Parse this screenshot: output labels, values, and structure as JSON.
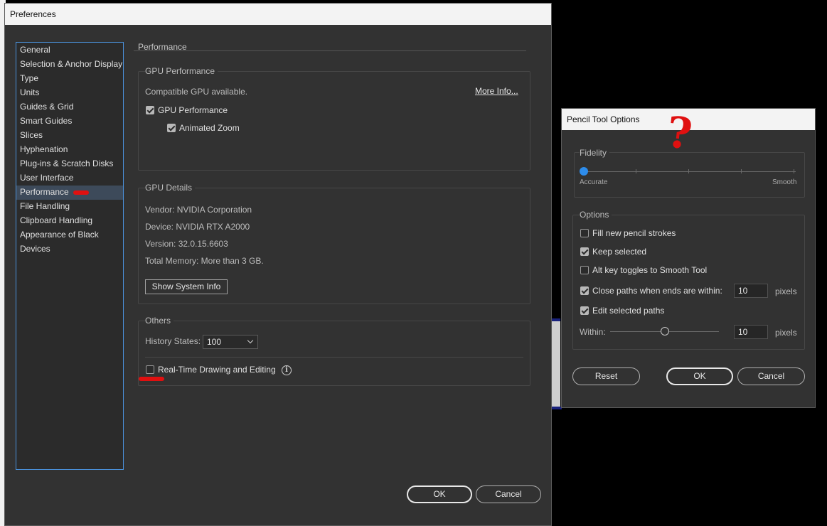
{
  "preferences": {
    "title": "Preferences",
    "nav": [
      "General",
      "Selection & Anchor Display",
      "Type",
      "Units",
      "Guides & Grid",
      "Smart Guides",
      "Slices",
      "Hyphenation",
      "Plug-ins & Scratch Disks",
      "User Interface",
      "Performance",
      "File Handling",
      "Clipboard Handling",
      "Appearance of Black",
      "Devices"
    ],
    "active_nav": "Performance",
    "section_title": "Performance",
    "gpu_performance": {
      "label": "GPU Performance",
      "compatible_text": "Compatible GPU available.",
      "more_info": "More Info...",
      "gpu_checkbox_label": "GPU Performance",
      "gpu_checked": true,
      "animated_zoom_label": "Animated Zoom",
      "animated_zoom_checked": true
    },
    "gpu_details": {
      "label": "GPU Details",
      "vendor": "Vendor: NVIDIA Corporation",
      "device": "Device: NVIDIA RTX A2000",
      "version": "Version: 32.0.15.6603",
      "memory": "Total Memory:  More than 3 GB.",
      "show_system_info": "Show System Info"
    },
    "others": {
      "label": "Others",
      "history_label": "History States:",
      "history_value": "100",
      "realtime_label": "Real-Time Drawing and Editing",
      "realtime_checked": false
    },
    "ok": "OK",
    "cancel": "Cancel"
  },
  "pencil": {
    "title": "Pencil Tool Options",
    "fidelity": {
      "label": "Fidelity",
      "left": "Accurate",
      "right": "Smooth",
      "value_fraction": 0.0
    },
    "options": {
      "label": "Options",
      "fill_label": "Fill new pencil strokes",
      "fill_checked": false,
      "keep_label": "Keep selected",
      "keep_checked": true,
      "alt_label": "Alt key toggles to Smooth Tool",
      "alt_checked": false,
      "close_label": "Close paths when ends are within:",
      "close_checked": true,
      "close_value": "10",
      "close_unit": "pixels",
      "edit_label": "Edit selected paths",
      "edit_checked": true,
      "within_label": "Within:",
      "within_value": "10",
      "within_unit": "pixels",
      "within_fraction": 0.5
    },
    "reset": "Reset",
    "ok": "OK",
    "cancel": "Cancel"
  },
  "annotations": {
    "question_mark": "?"
  },
  "colors": {
    "accent_blue": "#2d8ceb",
    "annotation_red": "#e01010",
    "panel_bg": "#323232"
  }
}
